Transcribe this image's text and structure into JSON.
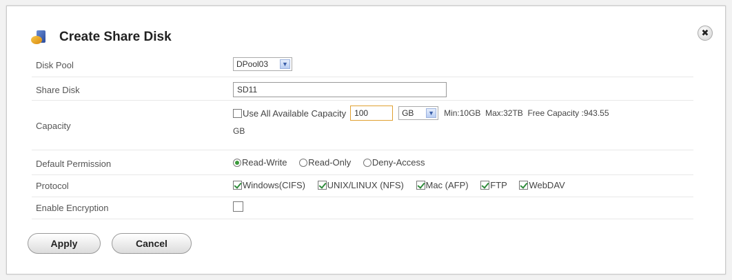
{
  "dialog": {
    "title": "Create Share Disk",
    "close_symbol": "✖"
  },
  "form": {
    "disk_pool": {
      "label": "Disk Pool",
      "value": "DPool03"
    },
    "share_disk": {
      "label": "Share Disk",
      "value": "SD11"
    },
    "capacity": {
      "label": "Capacity",
      "use_all_label": "Use All Available Capacity",
      "use_all_checked": false,
      "amount": "100",
      "unit": "GB",
      "info_line1": "Min:10GB  Max:32TB  Free Capacity :943.55",
      "info_line2": "GB"
    },
    "default_permission": {
      "label": "Default Permission",
      "options": [
        {
          "label": "Read-Write",
          "checked": true
        },
        {
          "label": "Read-Only",
          "checked": false
        },
        {
          "label": "Deny-Access",
          "checked": false
        }
      ]
    },
    "protocol": {
      "label": "Protocol",
      "options": [
        {
          "label": "Windows(CIFS)",
          "checked": true
        },
        {
          "label": "UNIX/LINUX (NFS)",
          "checked": true
        },
        {
          "label": "Mac (AFP)",
          "checked": true
        },
        {
          "label": "FTP",
          "checked": true
        },
        {
          "label": "WebDAV",
          "checked": true
        }
      ]
    },
    "encryption": {
      "label": "Enable Encryption",
      "checked": false
    }
  },
  "buttons": {
    "apply": "Apply",
    "cancel": "Cancel"
  }
}
